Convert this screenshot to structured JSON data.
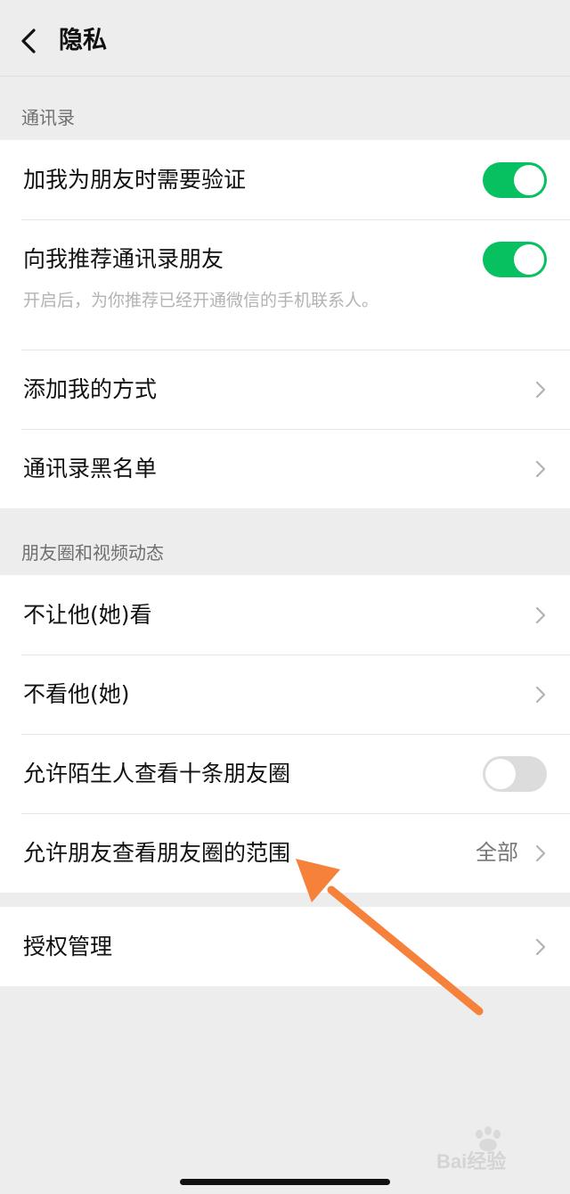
{
  "header": {
    "title": "隐私"
  },
  "sections": {
    "contacts": {
      "label": "通讯录",
      "rows": [
        {
          "label": "加我为朋友时需要验证",
          "toggle": "on"
        },
        {
          "label": "向我推荐通讯录朋友",
          "toggle": "on",
          "description": "开启后，为你推荐已经开通微信的手机联系人。"
        },
        {
          "label": "添加我的方式"
        },
        {
          "label": "通讯录黑名单"
        }
      ]
    },
    "moments": {
      "label": "朋友圈和视频动态",
      "rows": [
        {
          "label": "不让他(她)看"
        },
        {
          "label": "不看他(她)"
        },
        {
          "label": "允许陌生人查看十条朋友圈",
          "toggle": "off"
        },
        {
          "label": "允许朋友查看朋友圈的范围",
          "value": "全部"
        }
      ]
    },
    "auth": {
      "rows": [
        {
          "label": "授权管理"
        }
      ]
    }
  },
  "colors": {
    "toggle_on": "#07c160",
    "annotation_arrow": "#f5813a",
    "background": "#ededed"
  },
  "watermark": {
    "text": "Bai经验"
  }
}
